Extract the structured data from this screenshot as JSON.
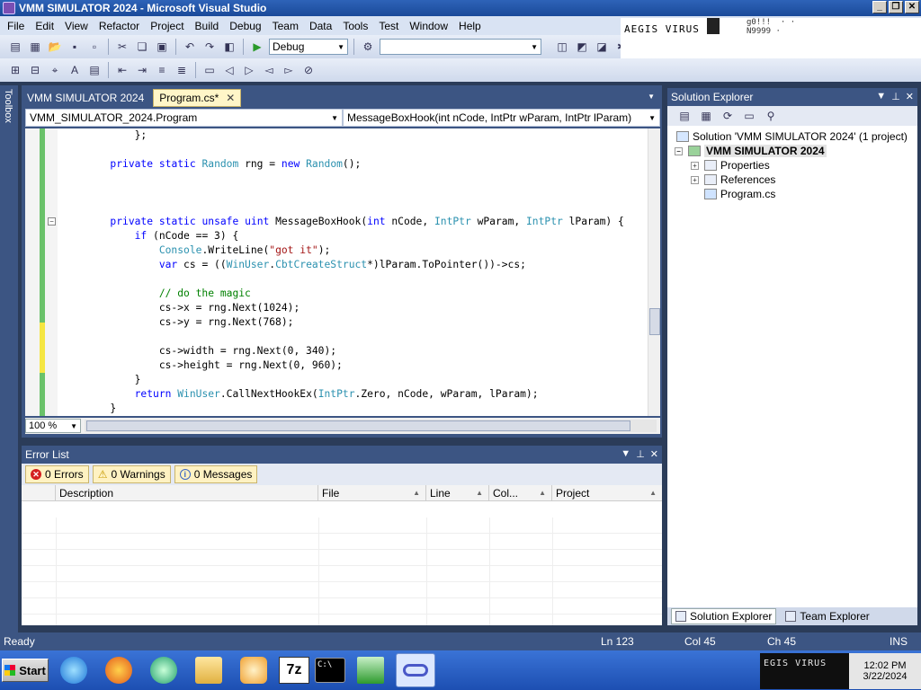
{
  "window": {
    "title": "VMM SIMULATOR 2024 - Microsoft Visual Studio"
  },
  "menu": [
    "File",
    "Edit",
    "View",
    "Refactor",
    "Project",
    "Build",
    "Debug",
    "Team",
    "Data",
    "Tools",
    "Test",
    "Window",
    "Help"
  ],
  "overlay": {
    "aegis_text": "AEGIS VIRUS",
    "aegis_fragment": "g0!!!  · ·\nN9999 ·",
    "tray_text": "EGIS VIRUS"
  },
  "toolbar": {
    "config_value": "Debug",
    "platform_value": ""
  },
  "toolbox": {
    "label": "Toolbox"
  },
  "tabs": {
    "doc1": "VMM SIMULATOR 2024",
    "doc2": "Program.cs*",
    "close_glyph": "✕"
  },
  "nav": {
    "class_combo": "VMM_SIMULATOR_2024.Program",
    "member_combo": "MessageBoxHook(int nCode, IntPtr wParam, IntPtr lParam)"
  },
  "code": {
    "lines": [
      "            };",
      "",
      "        private static Random rng = new Random();",
      "",
      "",
      "",
      "        private static unsafe uint MessageBoxHook(int nCode, IntPtr wParam, IntPtr lParam) {",
      "            if (nCode == 3) {",
      "                Console.WriteLine(\"got it\");",
      "                var cs = ((WinUser.CbtCreateStruct*)lParam.ToPointer())->cs;",
      "",
      "                // do the magic",
      "                cs->x = rng.Next(1024);",
      "                cs->y = rng.Next(768);",
      "",
      "                cs->width = rng.Next(0, 340);",
      "                cs->height = rng.Next(0, 960);",
      "            }",
      "            return WinUser.CallNextHookEx(IntPtr.Zero, nCode, wParam, lParam);",
      "        }"
    ]
  },
  "zoom": {
    "value": "100 %"
  },
  "errorlist": {
    "title": "Error List",
    "errors": "0 Errors",
    "warnings": "0 Warnings",
    "messages": "0 Messages",
    "columns": [
      "",
      "Description",
      "File",
      "Line",
      "Col...",
      "Project"
    ]
  },
  "solution": {
    "title": "Solution Explorer",
    "tree": {
      "solution": "Solution 'VMM SIMULATOR 2024' (1 project)",
      "project": "VMM SIMULATOR 2024",
      "properties": "Properties",
      "references": "References",
      "program": "Program.cs"
    },
    "tab1": "Solution Explorer",
    "tab2": "Team Explorer"
  },
  "status": {
    "ready": "Ready",
    "ln": "Ln 123",
    "col": "Col 45",
    "ch": "Ch 45",
    "ins": "INS"
  },
  "taskbar": {
    "start": "Start",
    "sevenzip": "7z",
    "cmd": "C:\\",
    "time": "12:02 PM",
    "date": "3/22/2024"
  }
}
